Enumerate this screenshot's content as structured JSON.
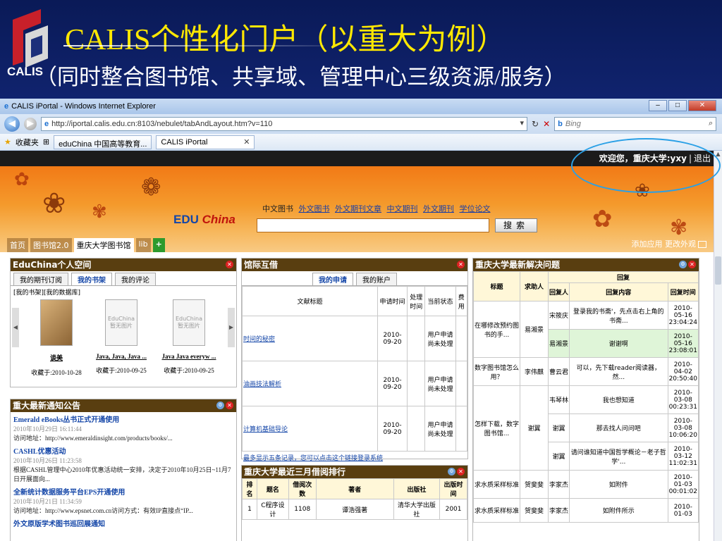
{
  "slide": {
    "logo_text": "CALIS",
    "title": "CALIS个性化门户（以重大为例）",
    "subtitle": "（同时整合图书馆、共享域、管理中心三级资源/服务）"
  },
  "browser": {
    "window_title": "CALIS iPortal - Windows Internet Explorer",
    "url": "http://iportal.calis.edu.cn:8103/nebulet/tabAndLayout.htm?v=110",
    "search_placeholder": "Bing",
    "favorites_label": "收藏夹",
    "tabs": [
      "eduChina 中国高等教育...",
      "CALIS iPortal"
    ]
  },
  "portal": {
    "welcome": "欢迎您，重庆大学:yxy",
    "logout": "退出",
    "edu_logo_1": "EDU",
    "edu_logo_2": "China",
    "search_category_active": "中文图书",
    "search_categories": [
      "外文图书",
      "外文期刊文章",
      "中文期刊",
      "外文期刊",
      "学位论文"
    ],
    "search_button": "搜索",
    "nav_tabs": [
      "首页",
      "图书馆2.0",
      "重庆大学图书馆",
      "lib"
    ],
    "nav_add": "+",
    "right_links": "添加应用 更改外观"
  },
  "space": {
    "title": "EduChina个人空间",
    "tabs": [
      "我的期刊订阅",
      "我的书架",
      "我的评论"
    ],
    "sublinks": "[我的书架][我的数据库]",
    "no_image": "暂无图片",
    "cover_brand": "EduChina",
    "books": [
      {
        "title": "谈美",
        "date": "收藏于:2010-10-28"
      },
      {
        "title": "Java, Java, Java ...",
        "date": "收藏于:2010-09-25"
      },
      {
        "title": "Java Java everyw ...",
        "date": "收藏于:2010-09-25"
      }
    ]
  },
  "notice": {
    "title": "重大最新通知公告",
    "items": [
      {
        "title": "Emerald eBooks丛书正式开通使用",
        "date": "2010年10月29日 16:11:44",
        "text": "访问地址：http://www.emeraldinsight.com/products/books/..."
      },
      {
        "title": "CASHL优惠活动",
        "date": "2010年10月26日 11:23:58",
        "text": "根据CASHL管理中心2010年优惠活动统一安排，决定于2010年10月25日~11月7日开展面向..."
      },
      {
        "title": "全新统计数据服务平台EPS开通使用",
        "date": "2010年10月21日 11:34:59",
        "text": "访问地址：http://www.epsnet.com.cn访问方式：有效IP直接点“IP..."
      },
      {
        "title": "外文原版学术图书巡回展通知",
        "date": "",
        "text": ""
      }
    ]
  },
  "ill": {
    "title": "馆际互借",
    "tabs": [
      "我的申请",
      "我的账户"
    ],
    "headers": [
      "文献标题",
      "申请时间",
      "处理时间",
      "当前状态",
      "费用"
    ],
    "rows": [
      {
        "title": "时间的秘密",
        "apply": "2010-09-20",
        "status": "用户申请尚未处理"
      },
      {
        "title": "油画技法解析",
        "apply": "2010-09-20",
        "status": "用户申请尚未处理"
      },
      {
        "title": "计算机基础导论",
        "apply": "2010-09-20",
        "status": "用户申请尚未处理"
      }
    ],
    "more": "最多显示五条记录，您可以点击这个链接登录系统"
  },
  "rank": {
    "title": "重庆大学最近三月借阅排行",
    "headers": [
      "排名",
      "题名",
      "借阅次数",
      "著者",
      "出版社",
      "出版时间"
    ],
    "rows": [
      {
        "rank": "1",
        "title": "C程序设计",
        "count": "1108",
        "author": "谭浩强著",
        "publisher": "清华大学出版社",
        "year": "2001"
      }
    ]
  },
  "qa": {
    "title": "重庆大学最新解决问题",
    "headers": [
      "标题",
      "求助人",
      "回复"
    ],
    "sub_headers": [
      "回复人",
      "回复内容",
      "回复时间"
    ],
    "groups": [
      {
        "title": "在哪修改预约图书的手...",
        "asker": "易湘景",
        "replies": [
          {
            "who": "宋筱庆",
            "content": "登录我的书斋'，先点击右上角的书斋...",
            "time": "2010-05-16 23:04:24"
          },
          {
            "who": "易湘景",
            "content": "谢谢啊",
            "time": "2010-05-16 23:08:01"
          }
        ]
      },
      {
        "title": "数字图书馆怎么用？",
        "asker": "李伟麒",
        "replies": [
          {
            "who": "曹云君",
            "content": "可以，先下载reader阅读器，然...",
            "time": "2010-04-02 20:50:40"
          }
        ]
      },
      {
        "title": "怎样下载，数字图书馆...",
        "asker": "谢翼",
        "replies": [
          {
            "who": "韦琴林",
            "content": "我也想知道",
            "time": "2010-03-08 00:23:31"
          },
          {
            "who": "谢翼",
            "content": "那去找人问问吧",
            "time": "2010-03-08 10:06:20"
          },
          {
            "who": "谢翼",
            "content": "请问谁知道中国哲学概论－老子哲学'...",
            "time": "2010-03-12 11:02:31"
          }
        ]
      },
      {
        "title": "求水质采样标准",
        "asker": "贺斐斐",
        "replies": [
          {
            "who": "李家杰",
            "content": "如附件",
            "time": "2010-01-03 00:01:02"
          }
        ]
      },
      {
        "title": "求水质采样标准",
        "asker": "贺斐斐",
        "replies": [
          {
            "who": "李家杰",
            "content": "如附件所示",
            "time": "2010-01-03"
          }
        ]
      }
    ]
  }
}
